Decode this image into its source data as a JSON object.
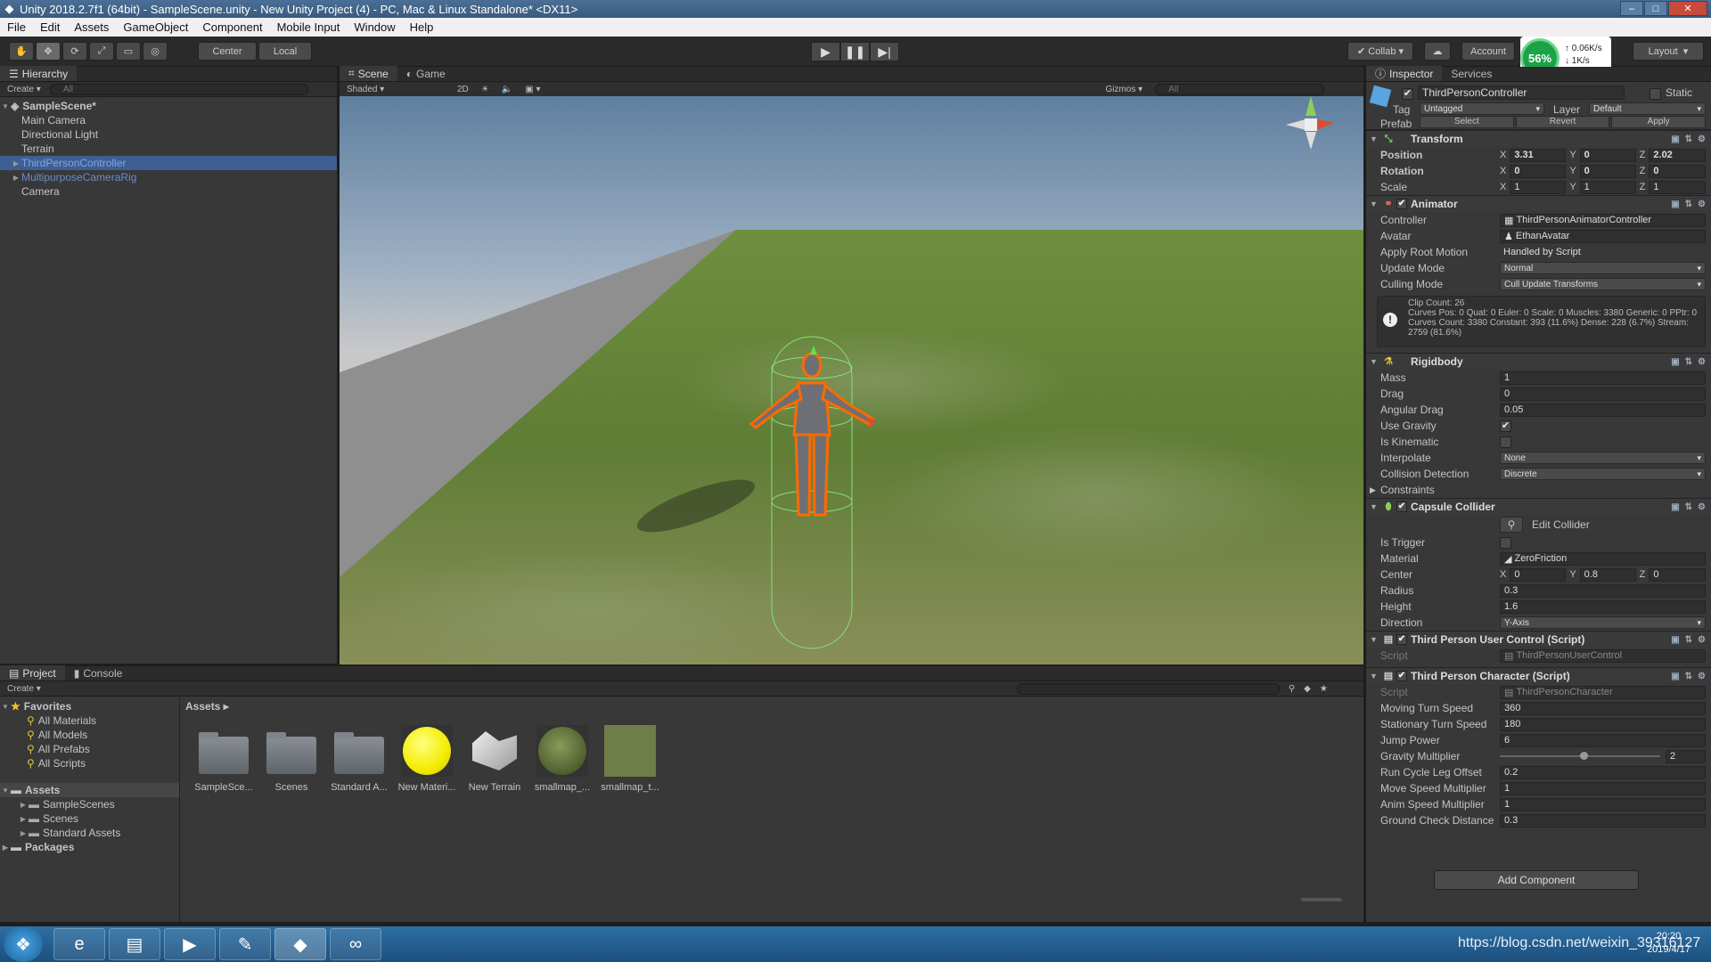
{
  "window": {
    "title": "Unity 2018.2.7f1 (64bit) - SampleScene.unity - New Unity Project (4) - PC, Mac & Linux Standalone* <DX11>"
  },
  "menu": [
    "File",
    "Edit",
    "Assets",
    "GameObject",
    "Component",
    "Mobile Input",
    "Window",
    "Help"
  ],
  "toolbar": {
    "pivot": "Center",
    "space": "Local",
    "collab": "Collab",
    "account": "Account",
    "layout": "Layout",
    "perf_percent": "56%",
    "net_up": "0.06K/s",
    "net_down": "1K/s"
  },
  "hierarchy": {
    "tab": "Hierarchy",
    "create": "Create",
    "search_placeholder": "All",
    "scene_name": "SampleScene*",
    "items": [
      {
        "label": "Main Camera",
        "color": "#c4c4c4",
        "expandable": false
      },
      {
        "label": "Directional Light",
        "color": "#c4c4c4",
        "expandable": false
      },
      {
        "label": "Terrain",
        "color": "#c4c4c4",
        "expandable": false
      },
      {
        "label": "ThirdPersonController",
        "color": "#7fa6e5",
        "expandable": true
      },
      {
        "label": "MultipurposeCameraRig",
        "color": "#6a8cc7",
        "expandable": true
      },
      {
        "label": "Camera",
        "color": "#c4c4c4",
        "expandable": false
      }
    ]
  },
  "scene": {
    "tabs": [
      "Scene",
      "Game"
    ],
    "shading": "Shaded",
    "mode_2d": "2D",
    "gizmos": "Gizmos",
    "search_placeholder": "All"
  },
  "inspector": {
    "tabs": [
      "Inspector",
      "Services"
    ],
    "object_name": "ThirdPersonController",
    "static_label": "Static",
    "tag_label": "Tag",
    "tag": "Untagged",
    "layer_label": "Layer",
    "layer": "Default",
    "prefab_label": "Prefab",
    "prefab_buttons": [
      "Select",
      "Revert",
      "Apply"
    ],
    "transform": {
      "title": "Transform",
      "position_label": "Position",
      "position": [
        "3.31",
        "0",
        "2.02"
      ],
      "rotation_label": "Rotation",
      "rotation": [
        "0",
        "0",
        "0"
      ],
      "scale_label": "Scale",
      "scale": [
        "1",
        "1",
        "1"
      ]
    },
    "animator": {
      "title": "Animator",
      "controller_label": "Controller",
      "controller": "ThirdPersonAnimatorController",
      "avatar_label": "Avatar",
      "avatar": "EthanAvatar",
      "root_motion_label": "Apply Root Motion",
      "root_motion": "Handled by Script",
      "update_mode_label": "Update Mode",
      "update_mode": "Normal",
      "culling_mode_label": "Culling Mode",
      "culling_mode": "Cull Update Transforms",
      "info": [
        "Clip Count: 26",
        "Curves Pos: 0 Quat: 0 Euler: 0 Scale: 0 Muscles: 3380 Generic: 0 PPtr: 0",
        "Curves Count: 3380 Constant: 393 (11.6%) Dense: 228 (6.7%) Stream: 2759 (81.6%)"
      ]
    },
    "rigidbody": {
      "title": "Rigidbody",
      "mass_label": "Mass",
      "mass": "1",
      "drag_label": "Drag",
      "drag": "0",
      "angular_drag_label": "Angular Drag",
      "angular_drag": "0.05",
      "use_gravity_label": "Use Gravity",
      "is_kinematic_label": "Is Kinematic",
      "interpolate_label": "Interpolate",
      "interpolate": "None",
      "collision_label": "Collision Detection",
      "collision": "Discrete",
      "constraints_label": "Constraints"
    },
    "capsule": {
      "title": "Capsule Collider",
      "edit_collider": "Edit Collider",
      "is_trigger_label": "Is Trigger",
      "material_label": "Material",
      "material": "ZeroFriction",
      "center_label": "Center",
      "center": [
        "0",
        "0.8",
        "0"
      ],
      "radius_label": "Radius",
      "radius": "0.3",
      "height_label": "Height",
      "height": "1.6",
      "direction_label": "Direction",
      "direction": "Y-Axis"
    },
    "user_control": {
      "title": "Third Person User Control (Script)",
      "script_label": "Script",
      "script": "ThirdPersonUserControl"
    },
    "character": {
      "title": "Third Person Character (Script)",
      "script_label": "Script",
      "script": "ThirdPersonCharacter",
      "fields": [
        {
          "label": "Moving Turn Speed",
          "value": "360"
        },
        {
          "label": "Stationary Turn Speed",
          "value": "180"
        },
        {
          "label": "Jump Power",
          "value": "6"
        },
        {
          "label": "Gravity Multiplier",
          "value": "2",
          "slider": 0.5
        },
        {
          "label": "Run Cycle Leg Offset",
          "value": "0.2"
        },
        {
          "label": "Move Speed Multiplier",
          "value": "1"
        },
        {
          "label": "Anim Speed Multiplier",
          "value": "1"
        },
        {
          "label": "Ground Check Distance",
          "value": "0.3"
        }
      ]
    },
    "add_component": "Add Component"
  },
  "project": {
    "tabs": [
      "Project",
      "Console"
    ],
    "create": "Create",
    "favorites_label": "Favorites",
    "favorites": [
      "All Materials",
      "All Models",
      "All Prefabs",
      "All Scripts"
    ],
    "assets_label": "Assets",
    "asset_folders": [
      "SampleScenes",
      "Scenes",
      "Standard Assets"
    ],
    "packages_label": "Packages",
    "breadcrumb": "Assets",
    "assets": [
      {
        "name": "SampleSce...",
        "kind": "folder"
      },
      {
        "name": "Scenes",
        "kind": "folder"
      },
      {
        "name": "Standard A...",
        "kind": "folder"
      },
      {
        "name": "New Materi...",
        "kind": "material-yellow"
      },
      {
        "name": "New Terrain",
        "kind": "terrain"
      },
      {
        "name": "smallmap_...",
        "kind": "material-green"
      },
      {
        "name": "smallmap_t...",
        "kind": "texture-green"
      }
    ]
  },
  "taskbar": {
    "clock_time": "20:20",
    "clock_date": "2019/4/17",
    "watermark": "https://blog.csdn.net/weixin_39316127"
  }
}
